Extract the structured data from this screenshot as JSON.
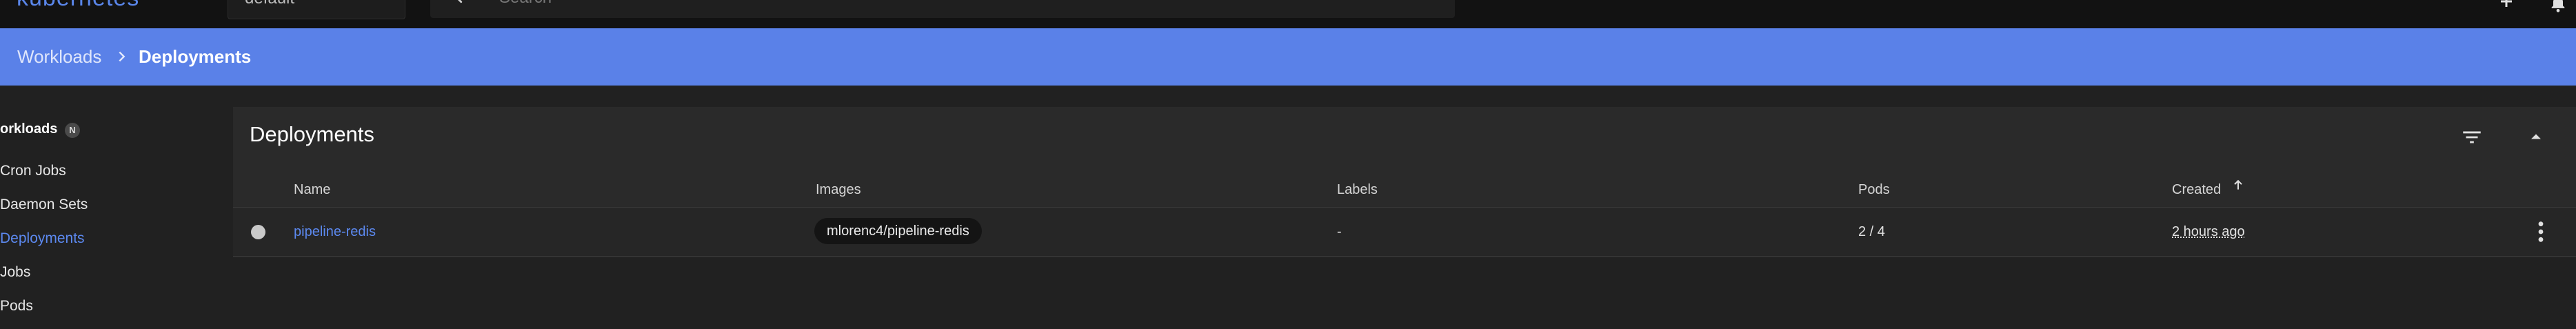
{
  "app": {
    "logo_text": "kubernetes"
  },
  "topbar": {
    "namespace_value": "default",
    "search_placeholder": "Search"
  },
  "breadcrumb": {
    "parent": "Workloads",
    "current": "Deployments"
  },
  "sidebar": {
    "header": "orkloads",
    "badge": "N",
    "items": [
      {
        "label": "Cron Jobs"
      },
      {
        "label": "Daemon Sets"
      },
      {
        "label": "Deployments",
        "active": true
      },
      {
        "label": "Jobs"
      },
      {
        "label": "Pods"
      }
    ]
  },
  "card": {
    "title": "Deployments",
    "columns": [
      "Name",
      "Images",
      "Labels",
      "Pods",
      "Created"
    ],
    "rows": [
      {
        "status": "pending",
        "name": "pipeline-redis",
        "image": "mlorenc4/pipeline-redis",
        "labels": "-",
        "pods": "2 / 4",
        "created": "2 hours ago"
      }
    ]
  },
  "colors": {
    "accent": "#5a81e8",
    "link": "#5c89f0",
    "background": "#212121",
    "card": "#2a2a2a",
    "toolbar": "#121212"
  },
  "icons": [
    "search-icon",
    "add-icon",
    "bell-icon",
    "chevron-right-icon",
    "filter-icon",
    "chevron-up-icon",
    "arrow-up-icon",
    "more-vert-icon"
  ]
}
